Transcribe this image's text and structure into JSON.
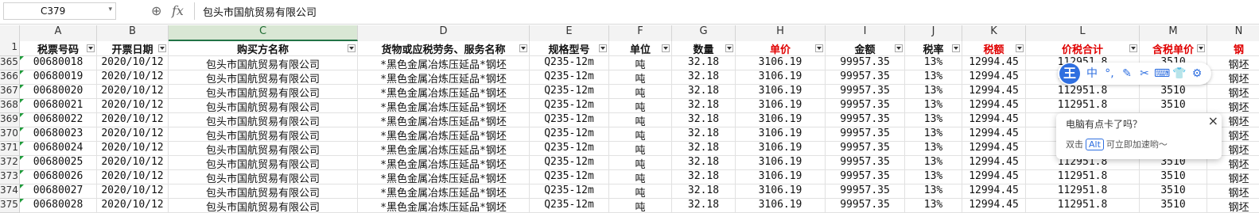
{
  "formula_bar": {
    "name_box": "C379",
    "zoom_icon": "zoom-icon",
    "fx_label": "fx",
    "formula": "包头市国航贸易有限公司"
  },
  "columns": [
    "A",
    "B",
    "C",
    "D",
    "E",
    "F",
    "G",
    "H",
    "I",
    "J",
    "K",
    "L",
    "M",
    "N"
  ],
  "header_row_number": "1",
  "headers": [
    "税票号码",
    "开票日期",
    "购买方名称",
    "货物或应税劳务、服务名称",
    "规格型号",
    "单位",
    "数量",
    "单价",
    "金额",
    "税率",
    "税额",
    "价税合计",
    "含税单价",
    "钢"
  ],
  "red_header_indices": [
    7,
    10,
    11,
    12,
    13
  ],
  "row_numbers": [
    "365",
    "366",
    "367",
    "368",
    "369",
    "370",
    "371",
    "372",
    "373",
    "374",
    "375"
  ],
  "rows": [
    [
      "00680018",
      "2020/10/12",
      "包头市国航贸易有限公司",
      "*黑色金属冶炼压延品*钢坯",
      "Q235-12m",
      "吨",
      "32.18",
      "3106.19",
      "99957.35",
      "13%",
      "12994.45",
      "112951.8",
      "3510",
      "钢坯"
    ],
    [
      "00680019",
      "2020/10/12",
      "包头市国航贸易有限公司",
      "*黑色金属冶炼压延品*钢坯",
      "Q235-12m",
      "吨",
      "32.18",
      "3106.19",
      "99957.35",
      "13%",
      "12994.45",
      "112951.8",
      "3510",
      "钢坯"
    ],
    [
      "00680020",
      "2020/10/12",
      "包头市国航贸易有限公司",
      "*黑色金属冶炼压延品*钢坯",
      "Q235-12m",
      "吨",
      "32.18",
      "3106.19",
      "99957.35",
      "13%",
      "12994.45",
      "112951.8",
      "3510",
      "钢坯"
    ],
    [
      "00680021",
      "2020/10/12",
      "包头市国航贸易有限公司",
      "*黑色金属冶炼压延品*钢坯",
      "Q235-12m",
      "吨",
      "32.18",
      "3106.19",
      "99957.35",
      "13%",
      "12994.45",
      "112951.8",
      "3510",
      "钢坯"
    ],
    [
      "00680022",
      "2020/10/12",
      "包头市国航贸易有限公司",
      "*黑色金属冶炼压延品*钢坯",
      "Q235-12m",
      "吨",
      "32.18",
      "3106.19",
      "99957.35",
      "13%",
      "12994.45",
      "",
      "",
      "钢坯"
    ],
    [
      "00680023",
      "2020/10/12",
      "包头市国航贸易有限公司",
      "*黑色金属冶炼压延品*钢坯",
      "Q235-12m",
      "吨",
      "32.18",
      "3106.19",
      "99957.35",
      "13%",
      "12994.45",
      "",
      "",
      "钢坯"
    ],
    [
      "00680024",
      "2020/10/12",
      "包头市国航贸易有限公司",
      "*黑色金属冶炼压延品*钢坯",
      "Q235-12m",
      "吨",
      "32.18",
      "3106.19",
      "99957.35",
      "13%",
      "12994.45",
      "",
      "",
      "钢坯"
    ],
    [
      "00680025",
      "2020/10/12",
      "包头市国航贸易有限公司",
      "*黑色金属冶炼压延品*钢坯",
      "Q235-12m",
      "吨",
      "32.18",
      "3106.19",
      "99957.35",
      "13%",
      "12994.45",
      "112951.8",
      "3510",
      "钢坯"
    ],
    [
      "00680026",
      "2020/10/12",
      "包头市国航贸易有限公司",
      "*黑色金属冶炼压延品*钢坯",
      "Q235-12m",
      "吨",
      "32.18",
      "3106.19",
      "99957.35",
      "13%",
      "12994.45",
      "112951.8",
      "3510",
      "钢坯"
    ],
    [
      "00680027",
      "2020/10/12",
      "包头市国航贸易有限公司",
      "*黑色金属冶炼压延品*钢坯",
      "Q235-12m",
      "吨",
      "32.18",
      "3106.19",
      "99957.35",
      "13%",
      "12994.45",
      "112951.8",
      "3510",
      "钢坯"
    ],
    [
      "00680028",
      "2020/10/12",
      "包头市国航贸易有限公司",
      "*黑色金属冶炼压延品*钢坯",
      "Q235-12m",
      "吨",
      "32.18",
      "3106.19",
      "99957.35",
      "13%",
      "12994.45",
      "112951.8",
      "3510",
      "钢坯"
    ]
  ],
  "toolbar": {
    "logo": "王",
    "buttons": [
      "中",
      "°,",
      "✎",
      "✂",
      "⌨",
      "👕",
      "⚙"
    ],
    "button_names": [
      "language-icon",
      "punctuation-icon",
      "handwriting-icon",
      "scissors-icon",
      "keyboard-icon",
      "skin-icon",
      "settings-icon"
    ]
  },
  "popup": {
    "title": "电脑有点卡了吗？",
    "prefix": "双击",
    "key": "Alt",
    "suffix": "可立即加速哟～",
    "close": "×"
  },
  "colors": {
    "accent_green": "#217346",
    "header_red": "#e00000",
    "ime_blue": "#2f6fe0"
  }
}
